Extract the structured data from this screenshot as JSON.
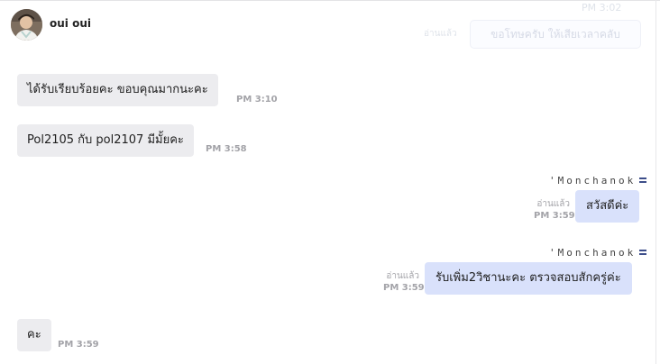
{
  "header": {
    "contact_name": "oui oui"
  },
  "ghost": {
    "time_label": "PM 3:02",
    "bubble_text": "ขอโทษครับ ให้เสียเวลาคลับ",
    "read_label": "อ่านแล้ว"
  },
  "messages": [
    {
      "direction": "incoming",
      "text": "ได้รับเรียบร้อยคะ ขอบคุณมากนะคะ",
      "time": "PM 3:10"
    },
    {
      "direction": "incoming",
      "text": "Pol2105 กับ pol2107 มีมั้ยคะ",
      "time": "PM 3:58"
    },
    {
      "direction": "outgoing",
      "sender": "'Monchanok",
      "text": "สวัสดีค่ะ",
      "read": "อ่านแล้ว",
      "time": "PM 3:59"
    },
    {
      "direction": "outgoing",
      "sender": "'Monchanok",
      "text": "รับเพิ่ม2วิชานะคะ ตรวจสอบสักครู่ค่ะ",
      "read": "อ่านแล้ว",
      "time": "PM 3:59"
    },
    {
      "direction": "incoming",
      "text": "คะ",
      "time": "PM 3:59"
    }
  ],
  "colors": {
    "incoming_bubble": "#ececef",
    "outgoing_bubble": "#d9e1fb",
    "time_text": "#a3a3a8",
    "sender_menu_icon": "#3d4e8a"
  }
}
